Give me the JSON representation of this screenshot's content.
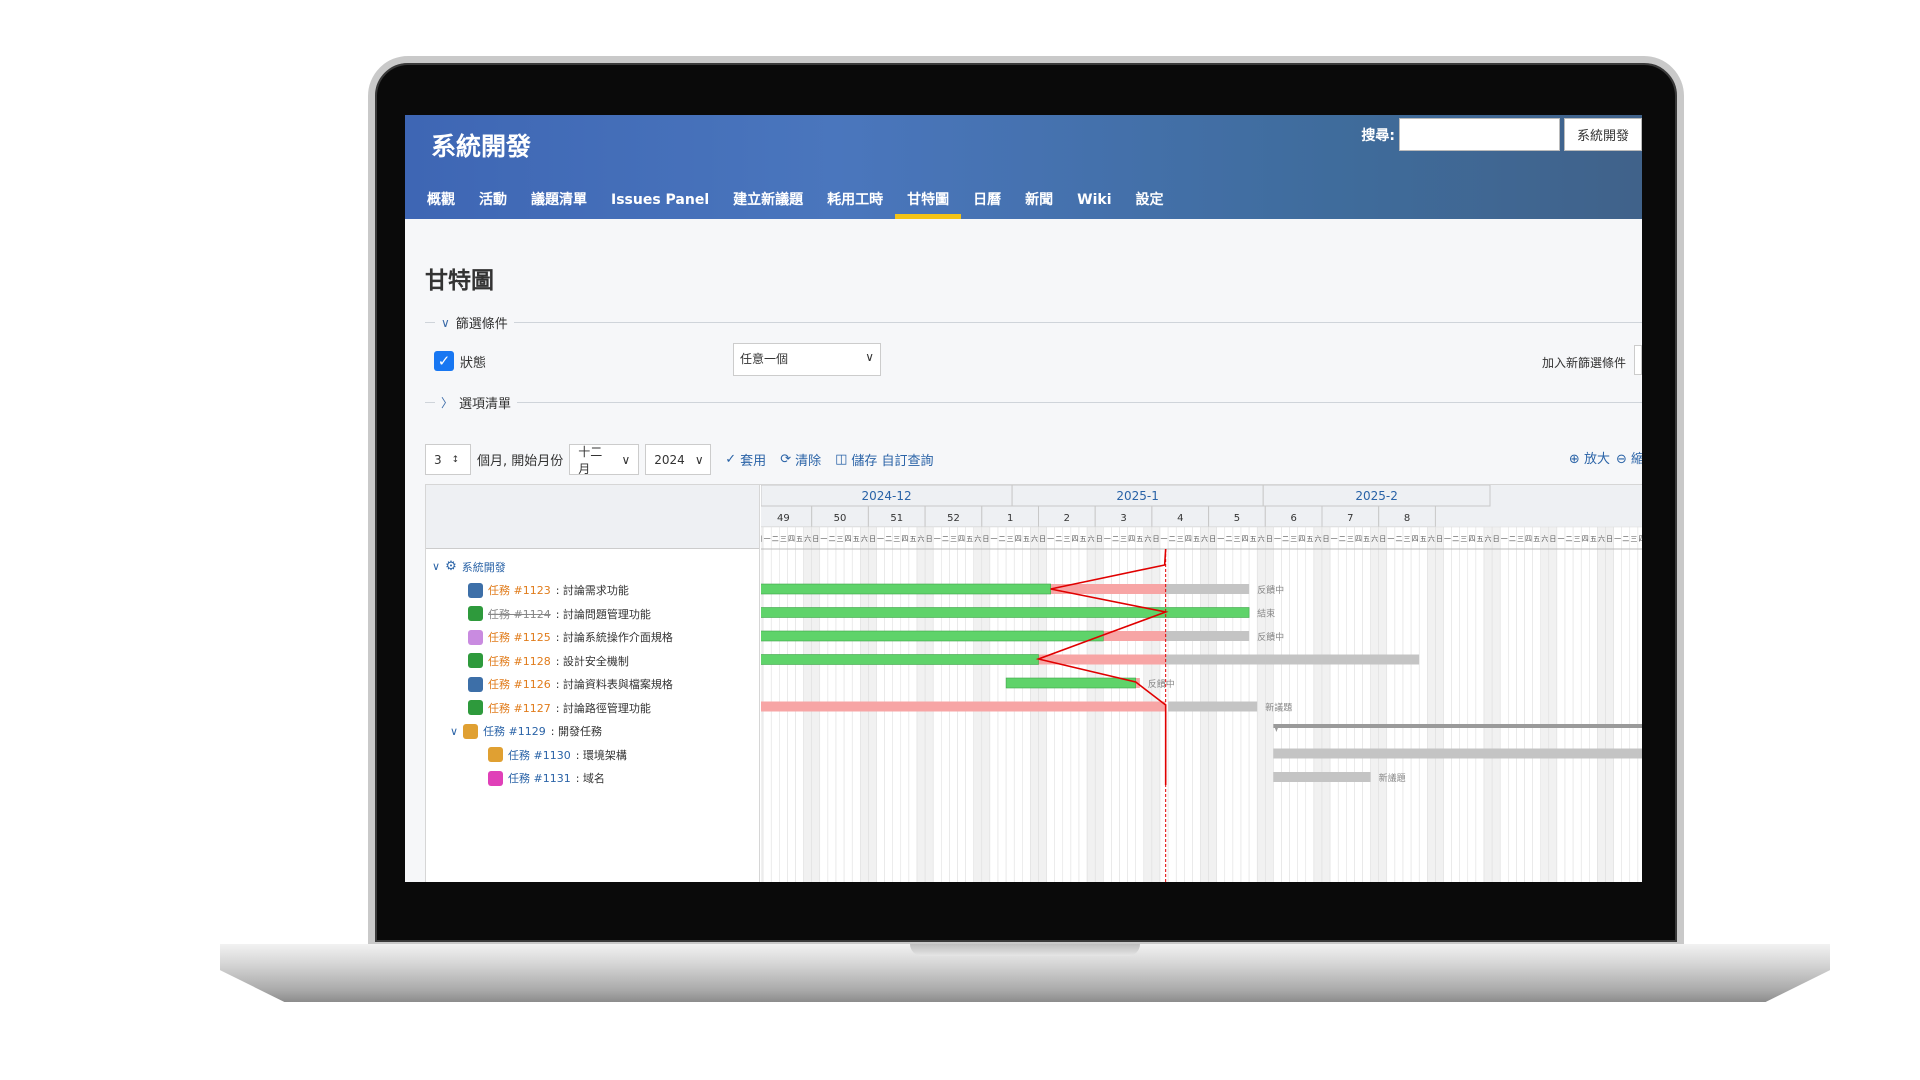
{
  "project": {
    "title": "系統開發"
  },
  "search": {
    "label": "搜尋:",
    "value": "",
    "jump_label": "系統開發"
  },
  "nav": {
    "tabs": [
      {
        "label": "概觀",
        "selected": false
      },
      {
        "label": "活動",
        "selected": false
      },
      {
        "label": "議題清單",
        "selected": false
      },
      {
        "label": "Issues Panel",
        "selected": false
      },
      {
        "label": "建立新議題",
        "selected": false
      },
      {
        "label": "耗用工時",
        "selected": false
      },
      {
        "label": "甘特圖",
        "selected": true
      },
      {
        "label": "日曆",
        "selected": false
      },
      {
        "label": "新聞",
        "selected": false
      },
      {
        "label": "Wiki",
        "selected": false
      },
      {
        "label": "設定",
        "selected": false
      }
    ]
  },
  "page": {
    "heading": "甘特圖"
  },
  "filters": {
    "legend": "篩選條件",
    "status_label": "狀態",
    "status_checked": true,
    "status_operator": "任意一個",
    "add_filter_label": "加入新篩選條件",
    "options_legend": "選項清單"
  },
  "toolbar": {
    "months_value": "3",
    "months_label": "個月, 開始月份",
    "month_select": "十二月",
    "year_select": "2024",
    "apply_label": "套用",
    "clear_label": "清除",
    "save_label": "儲存 自訂查詢",
    "zoom_in_label": "放大",
    "zoom_out_label": "縮"
  },
  "gantt": {
    "months": [
      "2024-12",
      "2025-1",
      "2025-2"
    ],
    "weeks": [
      "49",
      "50",
      "51",
      "52",
      "1",
      "2",
      "3",
      "4",
      "5",
      "6",
      "7",
      "8"
    ],
    "weekday_labels": [
      "日",
      "一",
      "二",
      "三",
      "四",
      "五",
      "六"
    ],
    "project_label": "系統開發",
    "issues": [
      {
        "tracker": "任務 #1123",
        "subject": "討論需求功能",
        "closed": false,
        "status": "反饋中",
        "icon": "hand-icon",
        "color": "#3d6fa8"
      },
      {
        "tracker": "任務 #1124",
        "subject": "討論問題管理功能",
        "closed": true,
        "status": "結束",
        "icon": "recycle-icon",
        "color": "#2e9a3c"
      },
      {
        "tracker": "任務 #1125",
        "subject": "討論系統操作介面規格",
        "closed": false,
        "status": "反饋中",
        "icon": "gift-icon",
        "color": "#c98be0"
      },
      {
        "tracker": "任務 #1128",
        "subject": "設計安全機制",
        "closed": false,
        "status": "",
        "icon": "gear-icon",
        "color": "#2e9a3c"
      },
      {
        "tracker": "任務 #1126",
        "subject": "討論資料表與檔案規格",
        "closed": false,
        "status": "反饋中",
        "icon": "hand-icon",
        "color": "#3d6fa8"
      },
      {
        "tracker": "任務 #1127",
        "subject": "討論路徑管理功能",
        "closed": false,
        "status": "新議題",
        "icon": "gear-icon",
        "color": "#2e9a3c"
      },
      {
        "tracker": "任務 #1129",
        "subject": "開發任務",
        "closed": false,
        "status": "",
        "icon": "people-icon",
        "color": "#e0a032"
      },
      {
        "tracker": "任務 #1130",
        "subject": "環境架構",
        "closed": false,
        "status": "",
        "icon": "people-icon",
        "color": "#e0a032"
      },
      {
        "tracker": "任務 #1131",
        "subject": "域名",
        "closed": false,
        "status": "新議題",
        "icon": "gift-icon",
        "color": "#e040b8"
      }
    ]
  },
  "colors": {
    "header_start": "#3e66b4",
    "header_end": "#40628a",
    "tab_highlight": "#f3c316",
    "done_bar": "#5fd36a",
    "late_bar": "#f7a5a5",
    "todo_bar": "#c4c4c4",
    "today_line": "#e00000",
    "link": "#2a63a7",
    "tracker_orange": "#e07b1a"
  }
}
